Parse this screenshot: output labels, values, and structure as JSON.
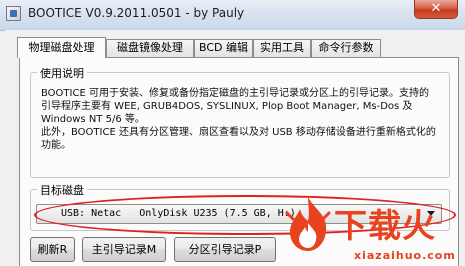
{
  "window": {
    "title": "BOOTICE V0.9.2011.0501 - by Pauly",
    "close_label": "✕"
  },
  "tabs": [
    {
      "label": "物理磁盘处理",
      "active": true
    },
    {
      "label": "磁盘镜像处理",
      "active": false
    },
    {
      "label": "BCD 编辑",
      "active": false
    },
    {
      "label": "实用工具",
      "active": false
    },
    {
      "label": "命令行参数",
      "active": false
    }
  ],
  "usage": {
    "legend": "使用说明",
    "text": "BOOTICE 可用于安装、修复或备份指定磁盘的主引导记录或分区上的引导记录。支持的引导程序主要有 WEE, GRUB4DOS, SYSLINUX, Plop Boot Manager, Ms-Dos 及 Windows NT 5/6 等。\n此外，BOOTICE 还具有分区管理、扇区查看以及对 USB 移动存储设备进行重新格式化的功能。"
  },
  "target": {
    "legend": "目标磁盘",
    "selected": "USB: Netac   OnlyDisk U235 (7.5 GB, H:)"
  },
  "buttons": {
    "refresh": "刷新R",
    "mbr": "主引导记录M",
    "pbr": "分区引导记录P"
  },
  "watermark": {
    "title": "下载火",
    "subtitle": "xiazaihuo.com"
  }
}
